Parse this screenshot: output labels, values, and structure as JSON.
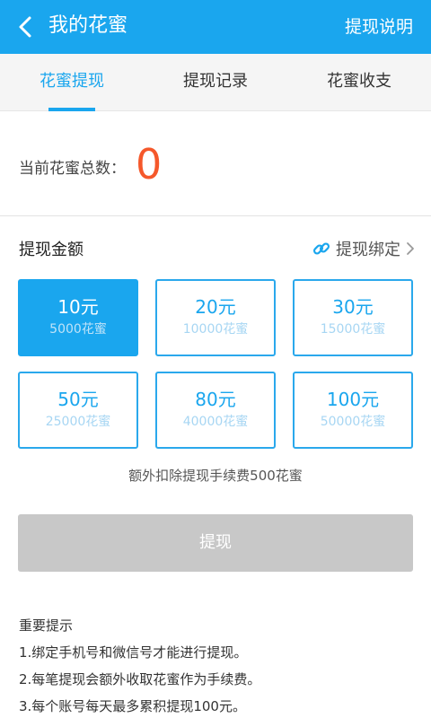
{
  "header": {
    "title": "我的花蜜",
    "help_label": "提现说明"
  },
  "tabs": [
    {
      "label": "花蜜提现",
      "active": true
    },
    {
      "label": "提现记录",
      "active": false
    },
    {
      "label": "花蜜收支",
      "active": false
    }
  ],
  "balance": {
    "label": "当前花蜜总数：",
    "value": "0"
  },
  "withdraw": {
    "title": "提现金额",
    "bind_label": "提现绑定",
    "options": [
      {
        "amount": "10元",
        "cost": "5000花蜜",
        "selected": true
      },
      {
        "amount": "20元",
        "cost": "10000花蜜",
        "selected": false
      },
      {
        "amount": "30元",
        "cost": "15000花蜜",
        "selected": false
      },
      {
        "amount": "50元",
        "cost": "25000花蜜",
        "selected": false
      },
      {
        "amount": "80元",
        "cost": "40000花蜜",
        "selected": false
      },
      {
        "amount": "100元",
        "cost": "50000花蜜",
        "selected": false
      }
    ],
    "fee_note": "额外扣除提现手续费500花蜜",
    "submit_label": "提现"
  },
  "notes": {
    "title": "重要提示",
    "items": [
      "1.绑定手机号和微信号才能进行提现。",
      "2.每笔提现会额外收取花蜜作为手续费。",
      "3.每个账号每天最多累积提现100元。"
    ]
  },
  "colors": {
    "accent": "#1aa6ee",
    "balance_value": "#f5582b",
    "disabled_button": "#c8c8c8"
  }
}
